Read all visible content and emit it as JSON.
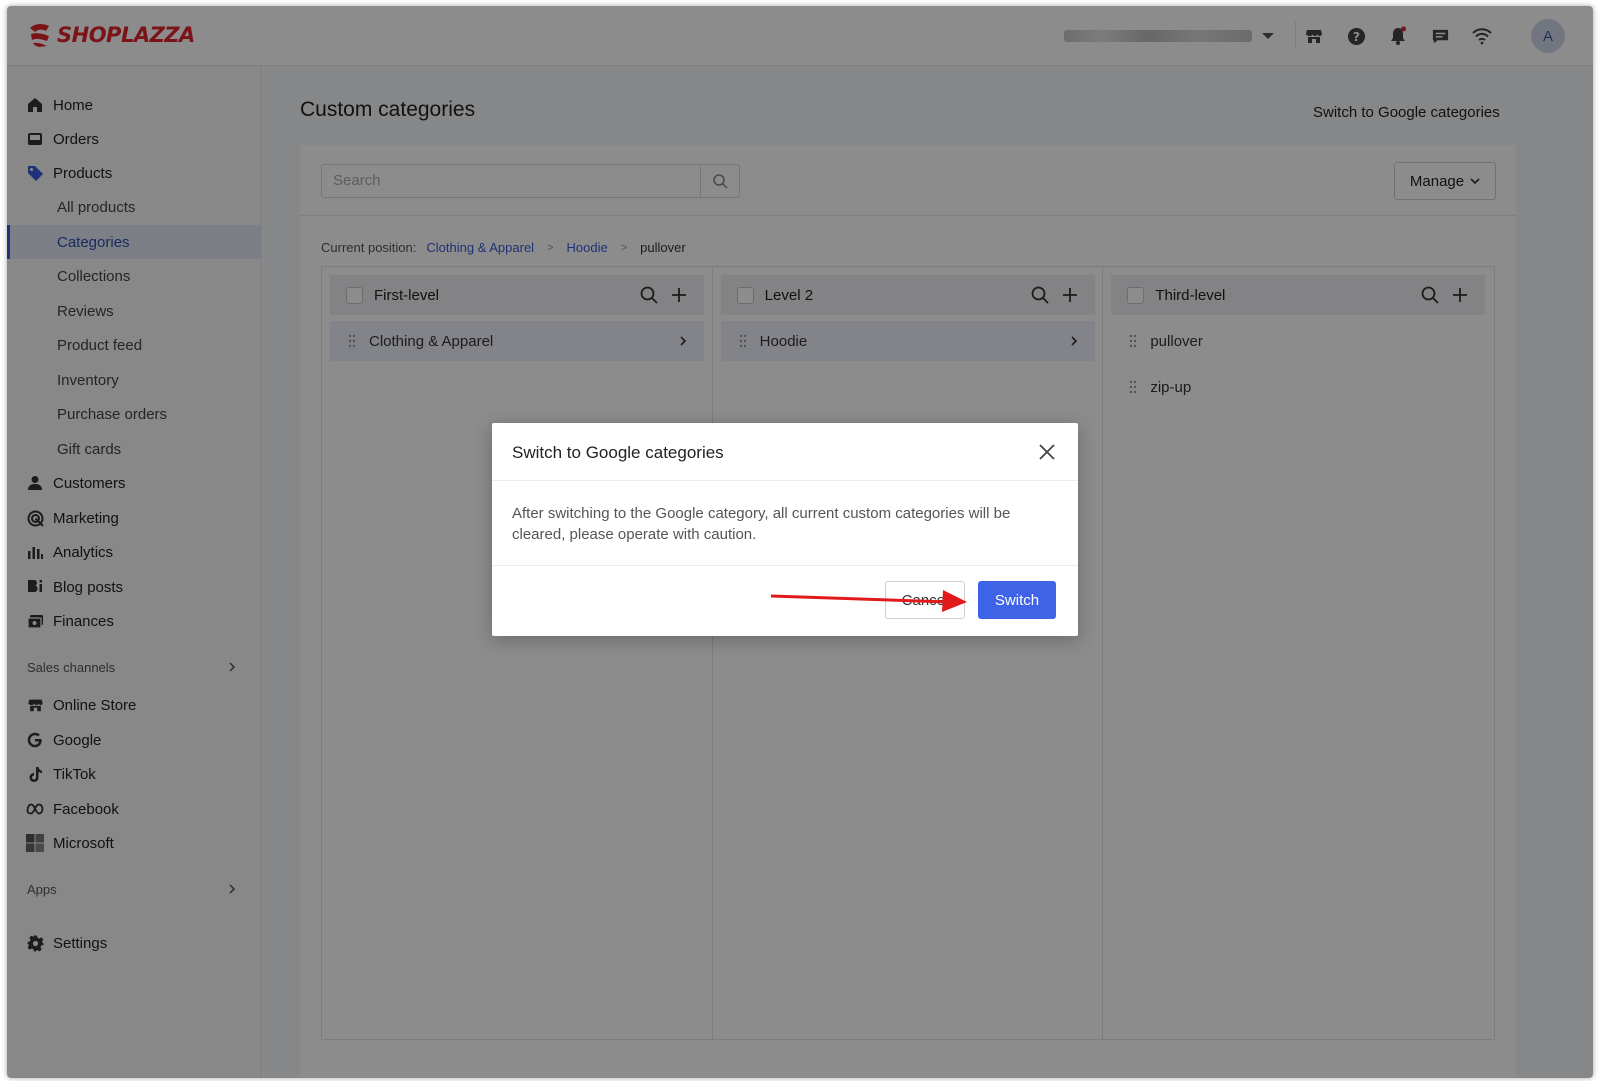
{
  "brand": {
    "name": "SHOPLAZZA",
    "color": "#e0262d"
  },
  "header": {
    "avatar_initial": "A",
    "icons": [
      "store-icon",
      "help-icon",
      "bell-icon",
      "message-icon",
      "wifi-icon"
    ]
  },
  "sidebar": {
    "items": [
      {
        "label": "Home",
        "icon": "home-icon"
      },
      {
        "label": "Orders",
        "icon": "orders-icon"
      },
      {
        "label": "Products",
        "icon": "tag-icon"
      }
    ],
    "product_sub": [
      {
        "label": "All products"
      },
      {
        "label": "Categories",
        "active": true
      },
      {
        "label": "Collections"
      },
      {
        "label": "Reviews"
      },
      {
        "label": "Product feed"
      },
      {
        "label": "Inventory"
      },
      {
        "label": "Purchase orders"
      },
      {
        "label": "Gift cards"
      }
    ],
    "items2": [
      {
        "label": "Customers",
        "icon": "person-icon"
      },
      {
        "label": "Marketing",
        "icon": "marketing-icon"
      },
      {
        "label": "Analytics",
        "icon": "analytics-icon"
      },
      {
        "label": "Blog posts",
        "icon": "blog-icon"
      },
      {
        "label": "Finances",
        "icon": "finances-icon"
      }
    ],
    "sales_channels_title": "Sales channels",
    "channels": [
      {
        "label": "Online Store",
        "icon": "store-icon"
      },
      {
        "label": "Google",
        "icon": "google-icon"
      },
      {
        "label": "TikTok",
        "icon": "tiktok-icon"
      },
      {
        "label": "Facebook",
        "icon": "meta-icon"
      },
      {
        "label": "Microsoft",
        "icon": "microsoft-icon"
      }
    ],
    "apps_title": "Apps",
    "settings_label": "Settings"
  },
  "main": {
    "title": "Custom categories",
    "switch_link": "Switch to Google categories",
    "search_placeholder": "Search",
    "manage_label": "Manage",
    "breadcrumb": {
      "label": "Current position:",
      "level1": "Clothing & Apparel",
      "level2": "Hoodie",
      "current": "pullover"
    },
    "columns": [
      {
        "title": "First-level",
        "rows": [
          "Clothing & Apparel"
        ]
      },
      {
        "title": "Level 2",
        "rows": [
          "Hoodie"
        ]
      },
      {
        "title": "Third-level",
        "rows": [
          "pullover",
          "zip-up"
        ]
      }
    ]
  },
  "modal": {
    "title": "Switch to Google categories",
    "body": "After switching to the Google category, all current custom categories will be cleared, please operate with caution.",
    "cancel_label": "Cancel",
    "confirm_label": "Switch",
    "confirm_color": "#3f63e6"
  }
}
